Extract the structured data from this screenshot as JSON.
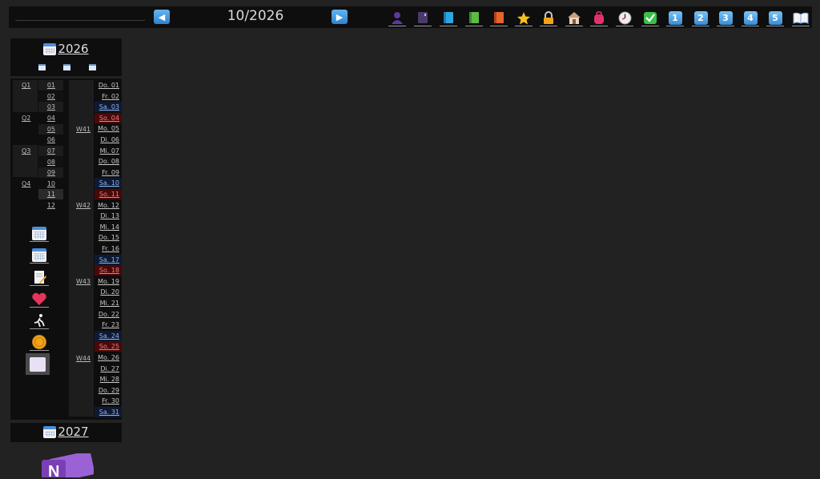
{
  "topbar": {
    "month_label": "10/2026",
    "icons": [
      "prev-arrow-icon",
      "next-arrow-icon",
      "person-icon",
      "dark-notebook-icon",
      "blue-book-icon",
      "green-book-icon",
      "orange-book-icon",
      "star-icon",
      "lock-icon",
      "house-icon",
      "backpack-icon",
      "clock-icon",
      "checkmark-icon",
      "number-1-icon",
      "number-2-icon",
      "number-3-icon",
      "number-4-icon",
      "number-5-icon",
      "open-book-icon"
    ],
    "numbers": [
      "1",
      "2",
      "3",
      "4",
      "5"
    ]
  },
  "year_panel": {
    "year": "2026"
  },
  "next_year": {
    "year": "2027"
  },
  "quarters": [
    "Q1",
    "Q2",
    "Q3",
    "Q4"
  ],
  "months": [
    "01",
    "02",
    "03",
    "04",
    "05",
    "06",
    "07",
    "08",
    "09",
    "10",
    "11",
    "12"
  ],
  "weeks": [
    "W41",
    "W42",
    "W43",
    "W44"
  ],
  "days": [
    {
      "label": "Do. 01",
      "kind": "weekday"
    },
    {
      "label": "Fr. 02",
      "kind": "weekday"
    },
    {
      "label": "Sa. 03",
      "kind": "sat"
    },
    {
      "label": "So. 04",
      "kind": "sun"
    },
    {
      "label": "Mo. 05",
      "kind": "weekday"
    },
    {
      "label": "Di. 06",
      "kind": "weekday"
    },
    {
      "label": "Mi. 07",
      "kind": "weekday"
    },
    {
      "label": "Do. 08",
      "kind": "weekday"
    },
    {
      "label": "Fr. 09",
      "kind": "weekday"
    },
    {
      "label": "Sa. 10",
      "kind": "sat"
    },
    {
      "label": "So. 11",
      "kind": "sun"
    },
    {
      "label": "Mo. 12",
      "kind": "weekday"
    },
    {
      "label": "Di. 13",
      "kind": "weekday"
    },
    {
      "label": "Mi. 14",
      "kind": "weekday"
    },
    {
      "label": "Do. 15",
      "kind": "weekday"
    },
    {
      "label": "Fr. 16",
      "kind": "weekday"
    },
    {
      "label": "Sa. 17",
      "kind": "sat"
    },
    {
      "label": "So. 18",
      "kind": "sun"
    },
    {
      "label": "Mo. 19",
      "kind": "weekday"
    },
    {
      "label": "Di. 20",
      "kind": "weekday"
    },
    {
      "label": "Mi. 21",
      "kind": "weekday"
    },
    {
      "label": "Do. 22",
      "kind": "weekday"
    },
    {
      "label": "Fr. 23",
      "kind": "weekday"
    },
    {
      "label": "Sa. 24",
      "kind": "sat"
    },
    {
      "label": "So. 25",
      "kind": "sun"
    },
    {
      "label": "Mo. 26",
      "kind": "weekday"
    },
    {
      "label": "Di. 27",
      "kind": "weekday"
    },
    {
      "label": "Mi. 28",
      "kind": "weekday"
    },
    {
      "label": "Do. 29",
      "kind": "weekday"
    },
    {
      "label": "Fr. 30",
      "kind": "weekday"
    },
    {
      "label": "Sa. 31",
      "kind": "sat"
    }
  ],
  "side_icons": [
    "calendar-icon",
    "calendar-icon",
    "notepad-pencil-icon",
    "heart-icon",
    "runner-icon",
    "coin-icon",
    "blank-page-icon"
  ],
  "colors": {
    "accent": "#3a8bd6",
    "saturday_bg": "#0e1a33",
    "sunday_bg": "#4a0808",
    "onenote_purple": "#7a3fb5"
  },
  "onenote_label": "N"
}
